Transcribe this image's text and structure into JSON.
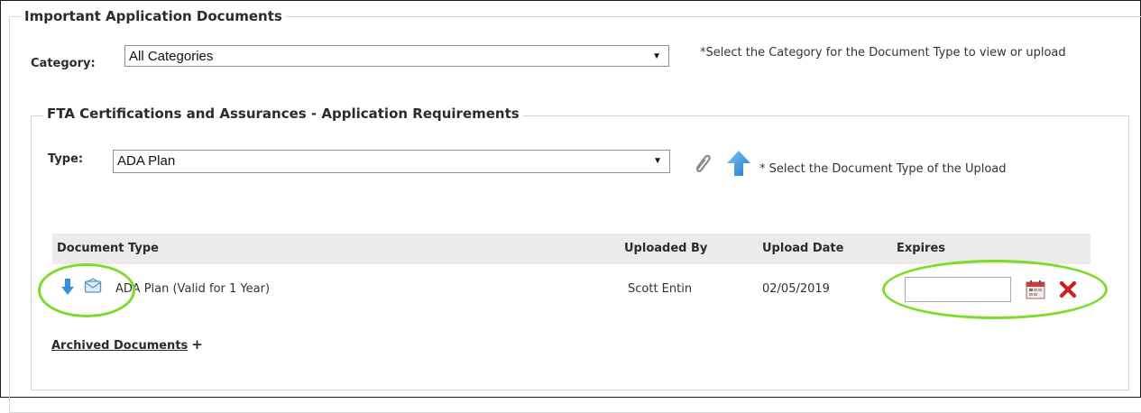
{
  "outer": {
    "legend": "Important Application Documents"
  },
  "category": {
    "label": "Category:",
    "selected": "All Categories",
    "arrow": "▼",
    "hint": "*Select the Category for the Document Type to view or upload"
  },
  "inner": {
    "legend": "FTA Certifications and Assurances - Application Requirements"
  },
  "type": {
    "label": "Type:",
    "selected": "ADA Plan",
    "arrow": "▼",
    "hint": "* Select the Document Type of the Upload",
    "icons": [
      "paperclip-icon",
      "upload-arrow-icon"
    ]
  },
  "table": {
    "headers": {
      "document_type": "Document Type",
      "uploaded_by": "Uploaded By",
      "upload_date": "Upload Date",
      "expires": "Expires"
    },
    "rows": [
      {
        "document_type": "ADA Plan (Valid for 1 Year)",
        "uploaded_by": "Scott Entin",
        "upload_date": "02/05/2019",
        "expires": "",
        "icons": [
          "download-arrow-icon",
          "email-icon",
          "calendar-icon",
          "delete-icon"
        ]
      }
    ]
  },
  "archived": {
    "label": "Archived Documents",
    "toggle": "+"
  },
  "colors": {
    "highlight": "#7cdc2a",
    "table_header_bg": "#ebebeb",
    "icon_blue": "#3b8fd9",
    "delete_red": "#cc1f1f"
  }
}
